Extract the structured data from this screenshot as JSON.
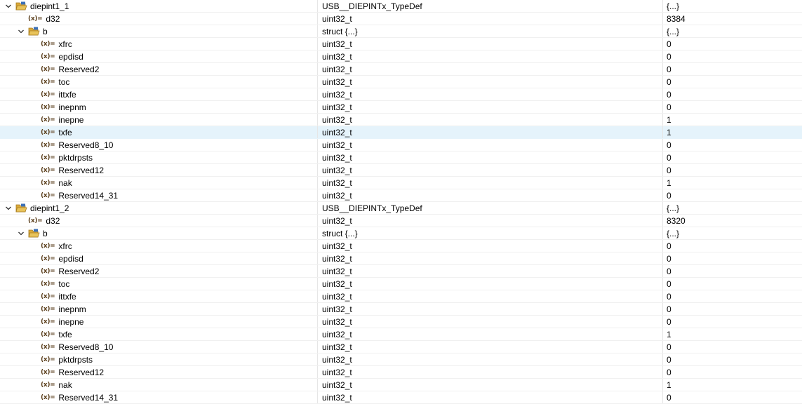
{
  "variables": [
    {
      "name": "diepint1_1",
      "type": "USB__DIEPINTx_TypeDef",
      "value": "{...}",
      "kind": "struct",
      "expanded": true,
      "children": [
        {
          "name": "d32",
          "type": "uint32_t",
          "value": "8384",
          "kind": "var"
        },
        {
          "name": "b",
          "type": "struct {...}",
          "value": "{...}",
          "kind": "struct",
          "expanded": true,
          "children": [
            {
              "name": "xfrc",
              "type": "uint32_t",
              "value": "0",
              "kind": "var"
            },
            {
              "name": "epdisd",
              "type": "uint32_t",
              "value": "0",
              "kind": "var"
            },
            {
              "name": "Reserved2",
              "type": "uint32_t",
              "value": "0",
              "kind": "var"
            },
            {
              "name": "toc",
              "type": "uint32_t",
              "value": "0",
              "kind": "var"
            },
            {
              "name": "ittxfe",
              "type": "uint32_t",
              "value": "0",
              "kind": "var"
            },
            {
              "name": "inepnm",
              "type": "uint32_t",
              "value": "0",
              "kind": "var"
            },
            {
              "name": "inepne",
              "type": "uint32_t",
              "value": "1",
              "kind": "var"
            },
            {
              "name": "txfe",
              "type": "uint32_t",
              "value": "1",
              "kind": "var",
              "selected": true
            },
            {
              "name": "Reserved8_10",
              "type": "uint32_t",
              "value": "0",
              "kind": "var"
            },
            {
              "name": "pktdrpsts",
              "type": "uint32_t",
              "value": "0",
              "kind": "var"
            },
            {
              "name": "Reserved12",
              "type": "uint32_t",
              "value": "0",
              "kind": "var"
            },
            {
              "name": "nak",
              "type": "uint32_t",
              "value": "1",
              "kind": "var"
            },
            {
              "name": "Reserved14_31",
              "type": "uint32_t",
              "value": "0",
              "kind": "var"
            }
          ]
        }
      ]
    },
    {
      "name": "diepint1_2",
      "type": "USB__DIEPINTx_TypeDef",
      "value": "{...}",
      "kind": "struct",
      "expanded": true,
      "children": [
        {
          "name": "d32",
          "type": "uint32_t",
          "value": "8320",
          "kind": "var"
        },
        {
          "name": "b",
          "type": "struct {...}",
          "value": "{...}",
          "kind": "struct",
          "expanded": true,
          "children": [
            {
              "name": "xfrc",
              "type": "uint32_t",
              "value": "0",
              "kind": "var"
            },
            {
              "name": "epdisd",
              "type": "uint32_t",
              "value": "0",
              "kind": "var"
            },
            {
              "name": "Reserved2",
              "type": "uint32_t",
              "value": "0",
              "kind": "var"
            },
            {
              "name": "toc",
              "type": "uint32_t",
              "value": "0",
              "kind": "var"
            },
            {
              "name": "ittxfe",
              "type": "uint32_t",
              "value": "0",
              "kind": "var"
            },
            {
              "name": "inepnm",
              "type": "uint32_t",
              "value": "0",
              "kind": "var"
            },
            {
              "name": "inepne",
              "type": "uint32_t",
              "value": "0",
              "kind": "var"
            },
            {
              "name": "txfe",
              "type": "uint32_t",
              "value": "1",
              "kind": "var"
            },
            {
              "name": "Reserved8_10",
              "type": "uint32_t",
              "value": "0",
              "kind": "var"
            },
            {
              "name": "pktdrpsts",
              "type": "uint32_t",
              "value": "0",
              "kind": "var"
            },
            {
              "name": "Reserved12",
              "type": "uint32_t",
              "value": "0",
              "kind": "var"
            },
            {
              "name": "nak",
              "type": "uint32_t",
              "value": "1",
              "kind": "var"
            },
            {
              "name": "Reserved14_31",
              "type": "uint32_t",
              "value": "0",
              "kind": "var"
            }
          ]
        }
      ]
    }
  ],
  "icons": {
    "expanded": "chevron-down-icon",
    "struct": "open-folder-icon",
    "variable": "variable-icon",
    "variable_glyph": "(x)="
  },
  "colors": {
    "selection": "#e5f3fb",
    "folder_body": "#e8c35a",
    "folder_tab": "#3b6fb6"
  }
}
